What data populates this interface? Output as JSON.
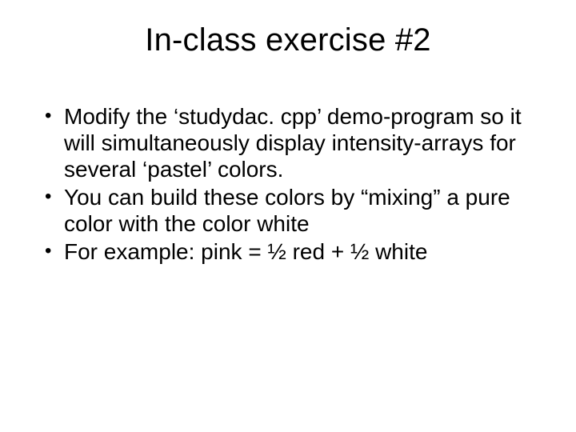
{
  "slide": {
    "title": "In-class exercise #2",
    "bullets": [
      "Modify the ‘studydac. cpp’ demo-program so it will simultaneously display intensity-arrays for several ‘pastel’ colors.",
      "You can build these colors by “mixing” a pure color with the color white",
      "For example:  pink = ½ red + ½ white"
    ]
  }
}
